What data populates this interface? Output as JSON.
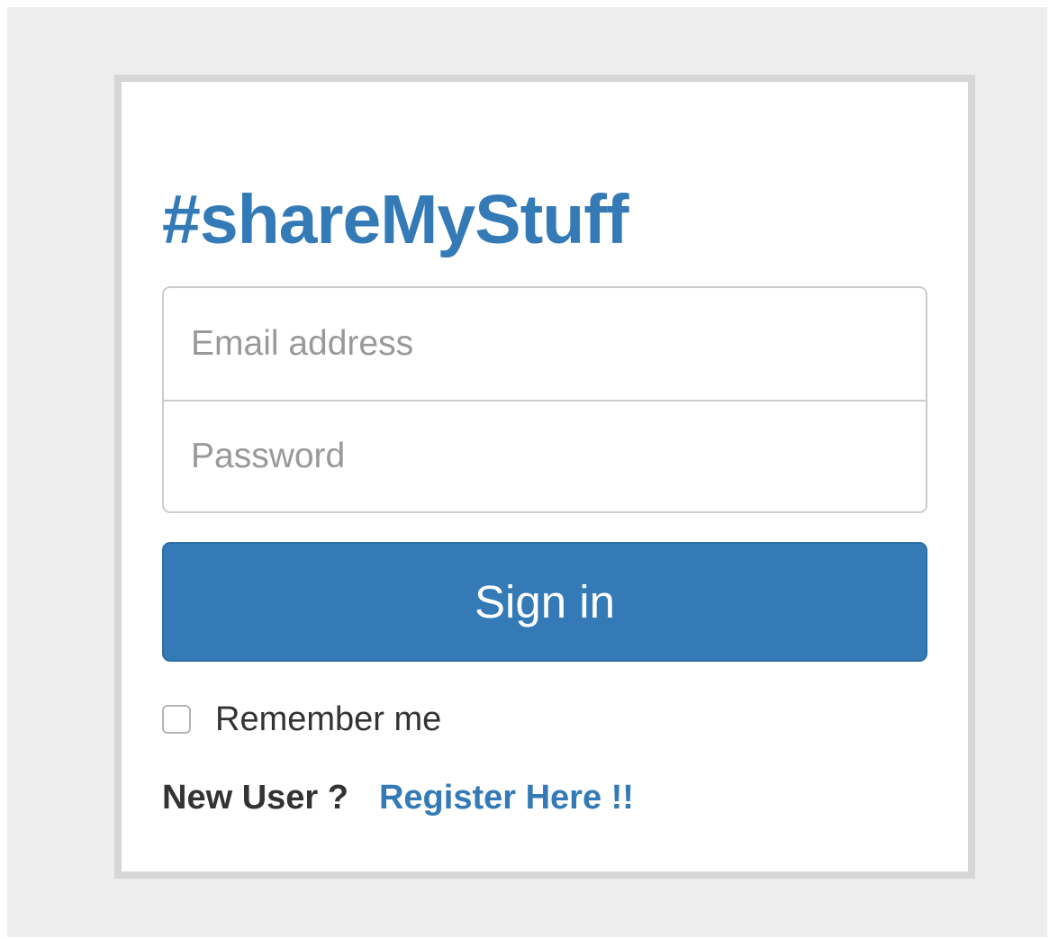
{
  "brand": {
    "title": "#shareMyStuff",
    "color": "#337ab7"
  },
  "form": {
    "email_placeholder": "Email address",
    "email_value": "",
    "password_placeholder": "Password",
    "password_value": "",
    "signin_label": "Sign in",
    "remember_label": "Remember me",
    "remember_checked": false
  },
  "footer": {
    "new_user_text": "New User ?",
    "register_link": "Register Here !!"
  },
  "colors": {
    "primary": "#337ab7",
    "page_background": "#ededed",
    "card_border": "#d6d6d6"
  }
}
